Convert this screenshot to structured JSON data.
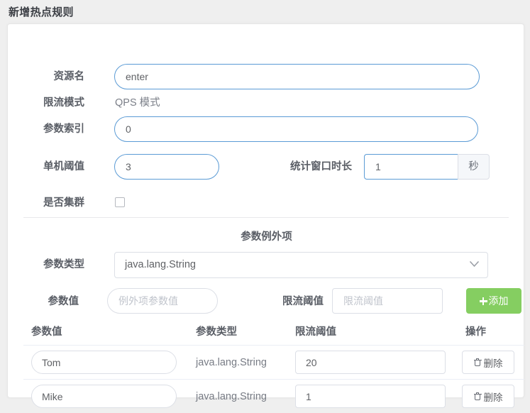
{
  "page_title": "新增热点规则",
  "form": {
    "resource_label": "资源名",
    "resource_value": "enter",
    "mode_label": "限流模式",
    "mode_value": "QPS 模式",
    "param_index_label": "参数索引",
    "param_index_value": "0",
    "threshold_label": "单机阈值",
    "threshold_value": "3",
    "window_label": "统计窗口时长",
    "window_value": "1",
    "window_unit": "秒",
    "cluster_label": "是否集群",
    "cluster_checked": false
  },
  "exception": {
    "section_title": "参数例外项",
    "param_type_label": "参数类型",
    "param_type_value": "java.lang.String",
    "param_value_label": "参数值",
    "param_value_placeholder": "例外项参数值",
    "threshold_label": "限流阈值",
    "threshold_placeholder": "限流阈值",
    "add_button": "添加"
  },
  "table": {
    "headers": {
      "value": "参数值",
      "type": "参数类型",
      "threshold": "限流阈值",
      "action": "操作"
    },
    "delete_label": "删除",
    "rows": [
      {
        "value": "Tom",
        "type": "java.lang.String",
        "threshold": "20"
      },
      {
        "value": "Mike",
        "type": "java.lang.String",
        "threshold": "1"
      }
    ]
  },
  "colors": {
    "page_background": "#efefef",
    "panel_background": "#ffffff",
    "accent_border": "#5b9bd5",
    "add_button": "#85ce61",
    "label_text": "#5a5e66",
    "placeholder": "#c0c4cc"
  }
}
